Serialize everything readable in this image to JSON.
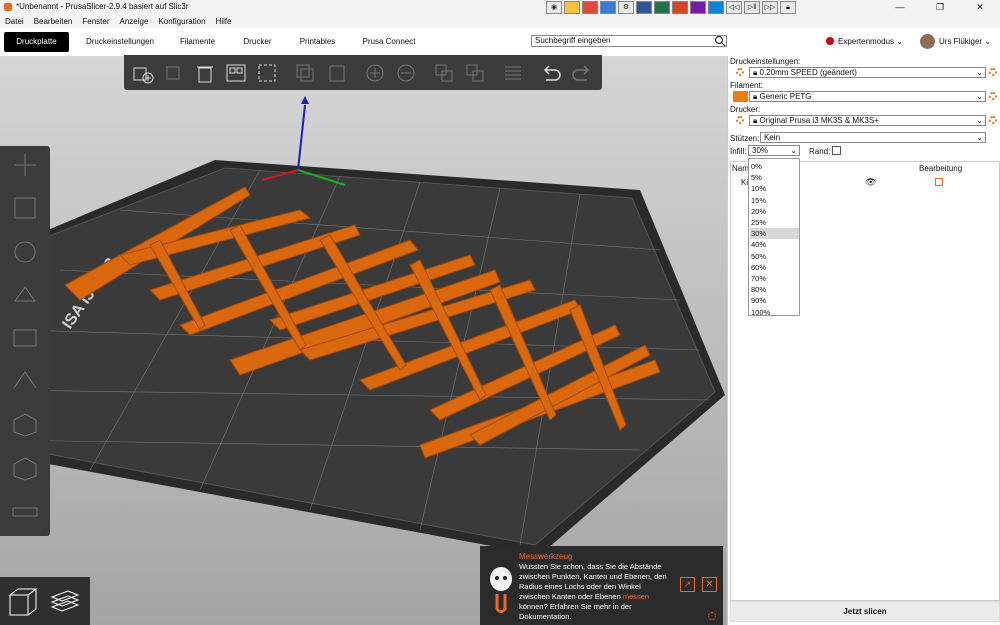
{
  "window": {
    "title": "*Unbenannt - PrusaSlicer-2.9.4 basiert auf Slic3r",
    "minimize": "—",
    "maximize": "❐",
    "close": "✕"
  },
  "menubar": [
    "Datei",
    "Bearbeiten",
    "Fenster",
    "Anzeige",
    "Konfiguration",
    "Hilfe"
  ],
  "tabs": [
    "Druckplatte",
    "Druckeinstellungen",
    "Filamente",
    "Drucker",
    "Printables",
    "Prusa Connect"
  ],
  "search": {
    "placeholder": "Suchbegriff eingeben"
  },
  "mode": {
    "label": "Expertenmodus",
    "color": "#d0021b"
  },
  "user": {
    "name": "Urs Flükiger"
  },
  "sidebar": {
    "print_settings_label": "Druckeinstellungen:",
    "print_settings_value": "0.20mm SPEED (geändert)",
    "filament_label": "Filament:",
    "filament_value": "Generic PETG",
    "filament_color": "#ed7c0b",
    "printer_label": "Drucker:",
    "printer_value": "Original Prusa i3 MK3S & MK3S+",
    "supports_label": "Stützen:",
    "supports_value": "Kein",
    "infill_label": "Infill:",
    "infill_value": "30%",
    "brim_label": "Rand:",
    "object_list": {
      "col_name": "Nam",
      "col_edit": "Bearbeitung",
      "row_name": "Kö"
    },
    "slice_button": "Jetzt slicen"
  },
  "infill_options": [
    "0%",
    "5%",
    "10%",
    "15%",
    "20%",
    "25%",
    "30%",
    "40%",
    "50%",
    "60%",
    "70%",
    "80%",
    "90%",
    "100%"
  ],
  "infill_selected_index": 6,
  "tip": {
    "title": "Messwerkzeug",
    "text_before": "Wussten Sie schon, dass Sie die Abstände zwischen Punkten, Kanten und Ebenen, den Radius eines Lochs oder den Winkel zwischen Kanten oder Ebenen ",
    "link": "messen",
    "text_after": " können? Erfahren Sie mehr in der Dokumentation."
  },
  "bed_label": "ISA i3 MK3",
  "accent_color": "#ed6b21"
}
